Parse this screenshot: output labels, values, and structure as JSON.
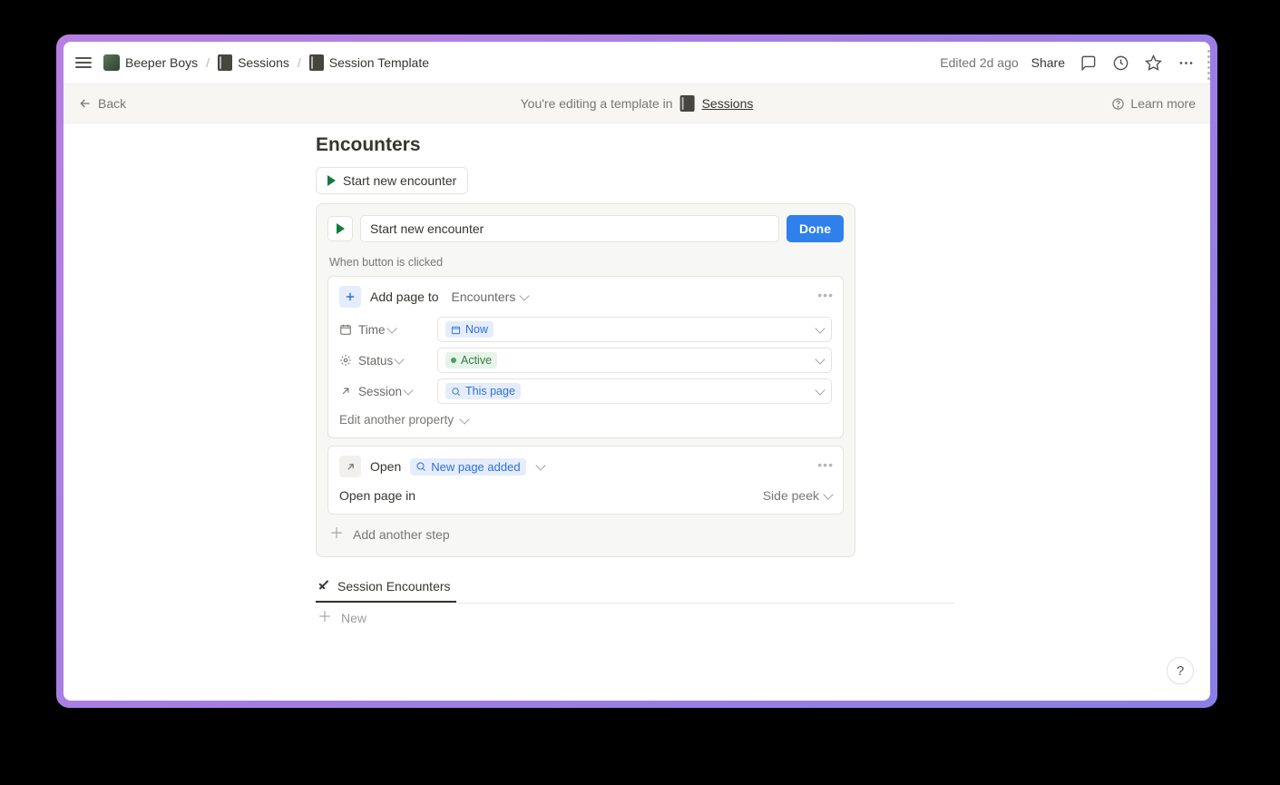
{
  "topbar": {
    "breadcrumbs": [
      "Beeper Boys",
      "Sessions",
      "Session Template"
    ],
    "edited": "Edited 2d ago",
    "share": "Share"
  },
  "banner": {
    "back": "Back",
    "msg": "You're editing a template in",
    "db": "Sessions",
    "learn": "Learn more"
  },
  "heading": "Encounters",
  "button": {
    "label": "Start new encounter",
    "edit_value": "Start new encounter",
    "done": "Done"
  },
  "when_label": "When button is clicked",
  "step1": {
    "action": "Add page to",
    "target": "Encounters",
    "props": [
      {
        "name": "Time",
        "value": "Now",
        "kind": "date"
      },
      {
        "name": "Status",
        "value": "Active",
        "kind": "status"
      },
      {
        "name": "Session",
        "value": "This page",
        "kind": "relation"
      }
    ],
    "edit_another": "Edit another property"
  },
  "step2": {
    "action": "Open",
    "target": "New page added",
    "open_in_label": "Open page in",
    "open_in_value": "Side peek"
  },
  "add_step": "Add another step",
  "view_tab": "Session Encounters",
  "new_row": "New"
}
